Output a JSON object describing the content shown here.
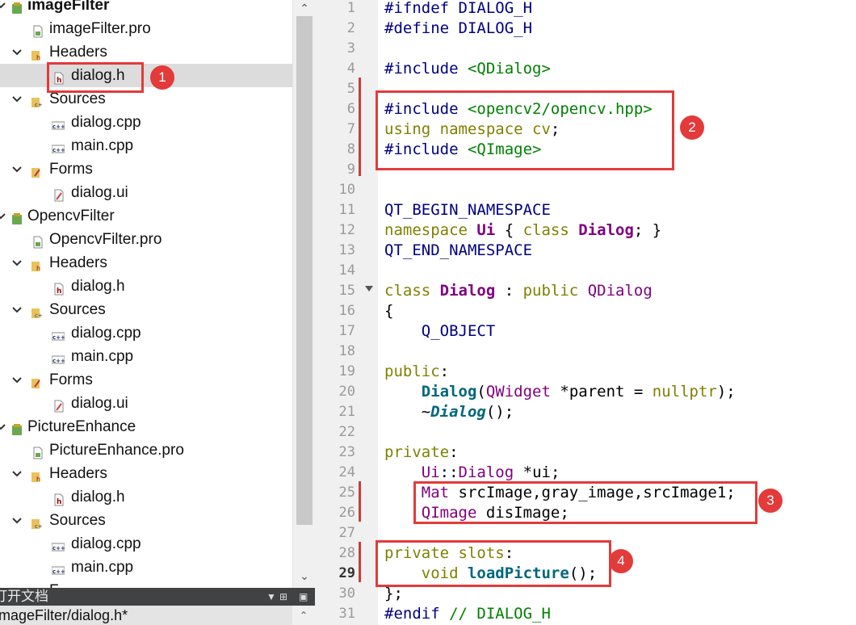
{
  "project_tree": {
    "rows": [
      {
        "label": "imageFilter",
        "type": "project",
        "depth": 0,
        "expanded": true,
        "bold": true
      },
      {
        "label": "imageFilter.pro",
        "type": "pro",
        "depth": 1
      },
      {
        "label": "Headers",
        "type": "folder-h",
        "depth": 1,
        "expanded": true
      },
      {
        "label": "dialog.h",
        "type": "header",
        "depth": 2,
        "selected": true
      },
      {
        "label": "Sources",
        "type": "folder-cpp",
        "depth": 1,
        "expanded": true
      },
      {
        "label": "dialog.cpp",
        "type": "cpp",
        "depth": 2
      },
      {
        "label": "main.cpp",
        "type": "cpp",
        "depth": 2
      },
      {
        "label": "Forms",
        "type": "folder-ui",
        "depth": 1,
        "expanded": true
      },
      {
        "label": "dialog.ui",
        "type": "ui",
        "depth": 2
      },
      {
        "label": "OpencvFilter",
        "type": "project",
        "depth": 0,
        "expanded": true
      },
      {
        "label": "OpencvFilter.pro",
        "type": "pro",
        "depth": 1
      },
      {
        "label": "Headers",
        "type": "folder-h",
        "depth": 1,
        "expanded": true
      },
      {
        "label": "dialog.h",
        "type": "header",
        "depth": 2
      },
      {
        "label": "Sources",
        "type": "folder-cpp",
        "depth": 1,
        "expanded": true
      },
      {
        "label": "dialog.cpp",
        "type": "cpp",
        "depth": 2
      },
      {
        "label": "main.cpp",
        "type": "cpp",
        "depth": 2
      },
      {
        "label": "Forms",
        "type": "folder-ui",
        "depth": 1,
        "expanded": true
      },
      {
        "label": "dialog.ui",
        "type": "ui",
        "depth": 2
      },
      {
        "label": "PictureEnhance",
        "type": "project",
        "depth": 0,
        "expanded": true
      },
      {
        "label": "PictureEnhance.pro",
        "type": "pro",
        "depth": 1
      },
      {
        "label": "Headers",
        "type": "folder-h",
        "depth": 1,
        "expanded": true
      },
      {
        "label": "dialog.h",
        "type": "header",
        "depth": 2
      },
      {
        "label": "Sources",
        "type": "folder-cpp",
        "depth": 1,
        "expanded": true
      },
      {
        "label": "dialog.cpp",
        "type": "cpp",
        "depth": 2
      },
      {
        "label": "main.cpp",
        "type": "cpp",
        "depth": 2
      },
      {
        "label": "F...",
        "type": "folder-ui",
        "depth": 1,
        "expanded": true
      }
    ]
  },
  "open_documents": {
    "title": "打开文档",
    "items": [
      "imageFilter/dialog.h*"
    ]
  },
  "editor": {
    "current_line": 29,
    "lines": [
      [
        [
          "pp",
          "#ifndef DIALOG_H"
        ]
      ],
      [
        [
          "pp",
          "#define DIALOG_H"
        ]
      ],
      [],
      [
        [
          "pp",
          "#include "
        ],
        [
          "str",
          "<QDialog>"
        ]
      ],
      [],
      [
        [
          "pp",
          "#include "
        ],
        [
          "str",
          "<opencv2/opencv.hpp>"
        ]
      ],
      [
        [
          "kw",
          "using namespace "
        ],
        [
          "kw",
          "cv"
        ],
        [
          "plain",
          ";"
        ]
      ],
      [
        [
          "pp",
          "#include "
        ],
        [
          "str",
          "<QImage>"
        ]
      ],
      [],
      [],
      [
        [
          "mac",
          "QT_BEGIN_NAMESPACE"
        ]
      ],
      [
        [
          "kw",
          "namespace "
        ],
        [
          "cls",
          "Ui"
        ],
        [
          "plain",
          " { "
        ],
        [
          "kw",
          "class "
        ],
        [
          "cls",
          "Dialog"
        ],
        [
          "plain",
          "; }"
        ]
      ],
      [
        [
          "mac",
          "QT_END_NAMESPACE"
        ]
      ],
      [],
      [
        [
          "kw",
          "class "
        ],
        [
          "cls",
          "Dialog"
        ],
        [
          "plain",
          " : "
        ],
        [
          "kw",
          "public "
        ],
        [
          "type",
          "QDialog"
        ]
      ],
      [
        [
          "plain",
          "{"
        ]
      ],
      [
        [
          "plain",
          "    "
        ],
        [
          "mac",
          "Q_OBJECT"
        ]
      ],
      [],
      [
        [
          "kw",
          "public"
        ],
        [
          "plain",
          ":"
        ]
      ],
      [
        [
          "plain",
          "    "
        ],
        [
          "fn",
          "Dialog"
        ],
        [
          "plain",
          "("
        ],
        [
          "type",
          "QWidget"
        ],
        [
          "plain",
          " *parent = "
        ],
        [
          "kw",
          "nullptr"
        ],
        [
          "plain",
          ");"
        ]
      ],
      [
        [
          "plain",
          "    ~"
        ],
        [
          "cls-it",
          "Dialog"
        ],
        [
          "plain",
          "();"
        ]
      ],
      [],
      [
        [
          "kw",
          "private"
        ],
        [
          "plain",
          ":"
        ]
      ],
      [
        [
          "plain",
          "    "
        ],
        [
          "type",
          "Ui"
        ],
        [
          "plain",
          "::"
        ],
        [
          "type",
          "Dialog"
        ],
        [
          "plain",
          " *ui;"
        ]
      ],
      [
        [
          "plain",
          "    "
        ],
        [
          "type",
          "Mat"
        ],
        [
          "plain",
          " srcImage,gray_image,srcImage1;"
        ]
      ],
      [
        [
          "plain",
          "    "
        ],
        [
          "type",
          "QImage"
        ],
        [
          "plain",
          " disImage;"
        ]
      ],
      [],
      [
        [
          "kw",
          "private slots"
        ],
        [
          "plain",
          ":"
        ]
      ],
      [
        [
          "plain",
          "    "
        ],
        [
          "kw",
          "void "
        ],
        [
          "fn",
          "loadPicture"
        ],
        [
          "plain",
          "();"
        ]
      ],
      [
        [
          "plain",
          "};"
        ]
      ],
      [
        [
          "pp",
          "#endif "
        ],
        [
          "cmt",
          "// DIALOG_H"
        ]
      ]
    ]
  },
  "annotations": [
    {
      "label": "1"
    },
    {
      "label": "2"
    },
    {
      "label": "3"
    },
    {
      "label": "4"
    }
  ],
  "colors": {
    "annotation_red": "#e33a3a",
    "preprocessor": "#000080",
    "string": "#008000",
    "keyword": "#808000",
    "class": "#800080"
  }
}
